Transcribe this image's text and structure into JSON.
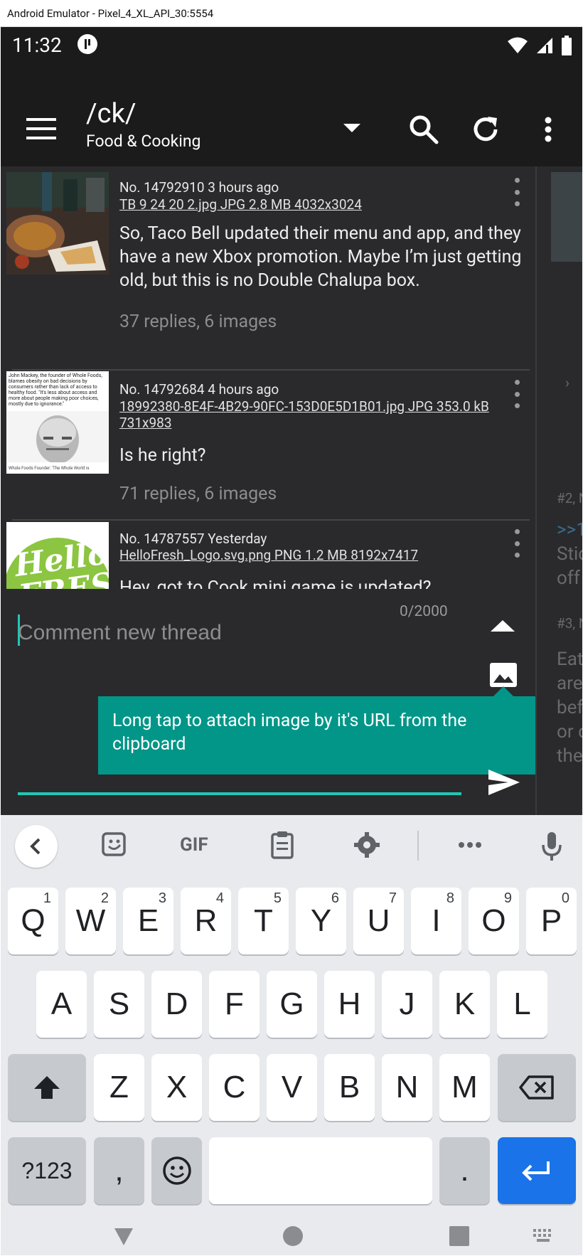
{
  "window": {
    "title": "Android Emulator - Pixel_4_XL_API_30:5554"
  },
  "status": {
    "time": "11:32"
  },
  "toolbar": {
    "board_code": "/ck/",
    "board_name": "Food & Cooking"
  },
  "threads": [
    {
      "meta": "No. 14792910 3 hours ago",
      "file": "TB 9 24 20 2.jpg JPG 2.8 MB 4032x3024",
      "body": "So, Taco Bell updated their menu and app, and they have a new Xbox promotion. Maybe I’m just getting old, but this is no Double Chalupa box.",
      "replies": "37 replies, 6 images"
    },
    {
      "meta": "No. 14792684 4 hours ago",
      "file": "18992380-8E4F-4B29-90FC-153D0E5D1B01.jpg JPG 353.0 kB 731x983",
      "body": "Is he right?",
      "replies": "71 replies, 6 images",
      "thumb_text": "John Mackey, the founder of Whole Foods, blames obesity on bad decisions by consumers rather than lack of access to healthy food. \"It's less about access and more about people making poor choices, mostly due to ignorance.\"",
      "thumb_caption": "Whole Foods Founder: 'The Whole World is"
    },
    {
      "meta": "No. 14787557 Yesterday",
      "file": "HelloFresh_Logo.svg.png PNG 1.2 MB 8192x7417",
      "body": "Hey, got to Cook mini game is updated?",
      "replies": "",
      "thumb_text": "Hello FRESH"
    }
  ],
  "side_peek": {
    "lines": [
      "#2, N",
      ">>1",
      "Stic",
      "off",
      "#3, N",
      "Eat",
      "are",
      "bef",
      "or c",
      "the"
    ]
  },
  "composer": {
    "placeholder": "Comment new thread",
    "value": "",
    "counter": "0/2000",
    "tooltip": "Long tap to attach image by it's URL from the clipboard"
  },
  "keyboard": {
    "tools": {
      "gif": "GIF"
    },
    "row1": [
      {
        "k": "Q",
        "h": "1"
      },
      {
        "k": "W",
        "h": "2"
      },
      {
        "k": "E",
        "h": "3"
      },
      {
        "k": "R",
        "h": "4"
      },
      {
        "k": "T",
        "h": "5"
      },
      {
        "k": "Y",
        "h": "6"
      },
      {
        "k": "U",
        "h": "7"
      },
      {
        "k": "I",
        "h": "8"
      },
      {
        "k": "O",
        "h": "9"
      },
      {
        "k": "P",
        "h": "0"
      }
    ],
    "row2": [
      "A",
      "S",
      "D",
      "F",
      "G",
      "H",
      "J",
      "K",
      "L"
    ],
    "row3": [
      "Z",
      "X",
      "C",
      "V",
      "B",
      "N",
      "M"
    ],
    "row4": {
      "symbols": "?123",
      "comma": ",",
      "period": "."
    }
  },
  "colors": {
    "accent": "#21c7b5",
    "tooltip": "#029688",
    "enter_key": "#1a73e8",
    "appbar": "#1b1b1c",
    "background": "#2a2a2c"
  },
  "icons": [
    "menu-icon",
    "caret-down-icon",
    "search-icon",
    "refresh-icon",
    "more-vert-icon",
    "image-icon",
    "send-icon",
    "keyboard-back-icon",
    "sticker-icon",
    "clipboard-icon",
    "settings-icon",
    "more-horiz-icon",
    "mic-icon",
    "shift-icon",
    "backspace-icon",
    "emoji-icon",
    "enter-icon",
    "nav-back-icon",
    "nav-home-icon",
    "nav-recents-icon",
    "nav-keyboard-icon"
  ]
}
